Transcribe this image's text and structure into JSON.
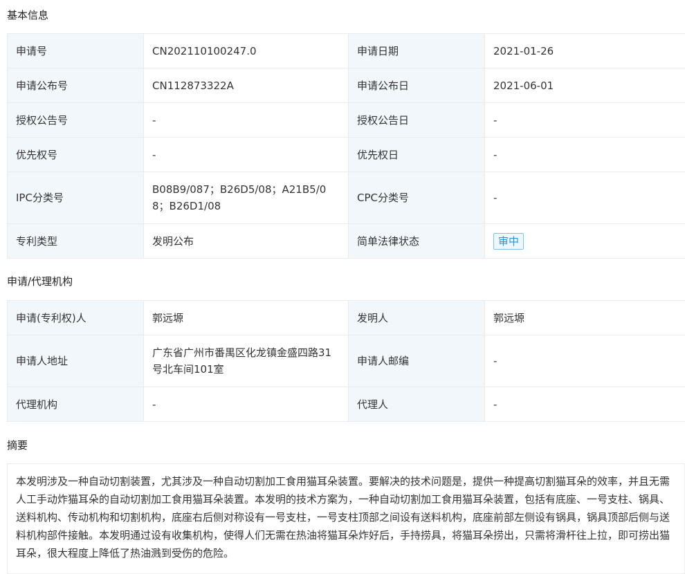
{
  "sections": {
    "basic": "基本信息",
    "agency": "申请/代理机构",
    "abstract": "摘要"
  },
  "basic_rows": [
    {
      "l1": "申请号",
      "v1": "CN202110100247.0",
      "l2": "申请日期",
      "v2": "2021-01-26"
    },
    {
      "l1": "申请公布号",
      "v1": "CN112873322A",
      "l2": "申请公布日",
      "v2": "2021-06-01"
    },
    {
      "l1": "授权公告号",
      "v1": "-",
      "l2": "授权公告日",
      "v2": "-"
    },
    {
      "l1": "优先权号",
      "v1": "-",
      "l2": "优先权日",
      "v2": "-"
    },
    {
      "l1": "IPC分类号",
      "v1": "B08B9/087；B26D5/08；A21B5/08；B26D1/08",
      "l2": "CPC分类号",
      "v2": "-"
    },
    {
      "l1": "专利类型",
      "v1": "发明公布",
      "l2": "简单法律状态",
      "v2": "审中"
    }
  ],
  "agency_rows": [
    {
      "l1": "申请(专利权)人",
      "v1": "郭远塬",
      "l2": "发明人",
      "v2": "郭远塬"
    },
    {
      "l1": "申请人地址",
      "v1": "广东省广州市番禺区化龙镇金盛四路31号北车间101室",
      "l2": "申请人邮编",
      "v2": "-"
    },
    {
      "l1": "代理机构",
      "v1": "-",
      "l2": "代理人",
      "v2": "-"
    }
  ],
  "abstract_text": "本发明涉及一种自动切割装置，尤其涉及一种自动切割加工食用猫耳朵装置。要解决的技术问题是，提供一种提高切割猫耳朵的效率，并且无需人工手动炸猫耳朵的自动切割加工食用猫耳朵装置。本发明的技术方案为，一种自动切割加工食用猫耳朵装置，包括有底座、一号支柱、锅具、送料机构、传动机构和切割机构，底座右后侧对称设有一号支柱，一号支柱顶部之间设有送料机构，底座前部左侧设有锅具，锅具顶部后侧与送料机构部件接触。本发明通过设有收集机构，使得人们无需在热油将猫耳朵炸好后，手持捞具，将猫耳朵捞出，只需将滑杆往上拉，即可捞出猫耳朵，很大程度上降低了热油溅到受伤的危险。",
  "colors": {
    "label_bg": "#f2f7fc",
    "border": "#e8ecf0",
    "status_tag": "#2496e0"
  }
}
